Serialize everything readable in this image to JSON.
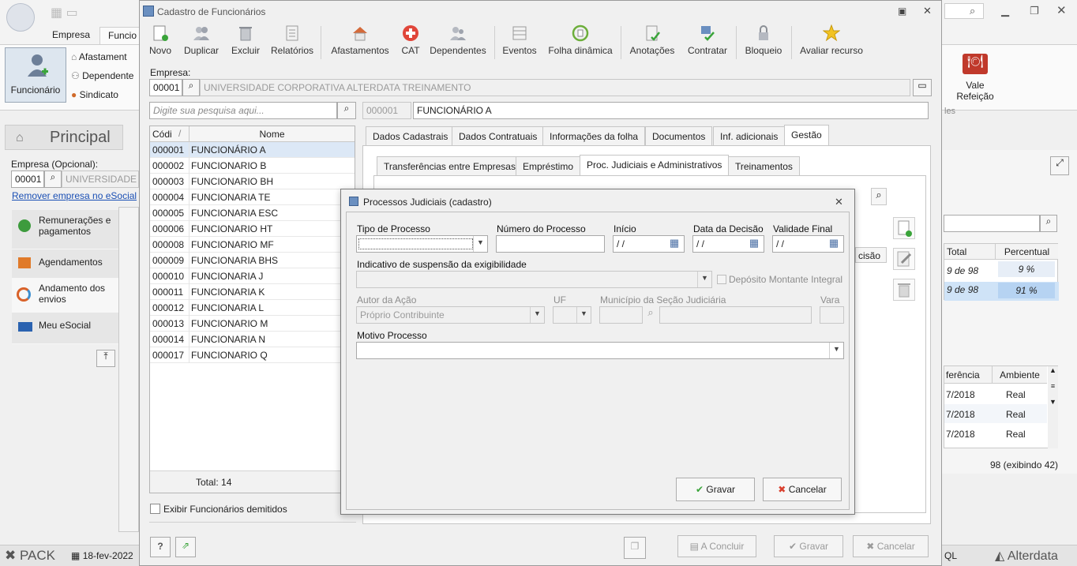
{
  "background": {
    "tabs": [
      "Empresa",
      "Funcio"
    ],
    "ribbon_big_button": "Funcionário",
    "ribbon_items": [
      "Afastament",
      "Dependente",
      "Sindicato"
    ],
    "ribbon_vale": "Vale Refeição",
    "ribbon_group": "les",
    "side_title": "Principal",
    "empresa_label": "Empresa (Opcional):",
    "empresa_code": "00001",
    "empresa_name": "UNIVERSIDADE C",
    "remove_link": "Remover empresa no eSocial",
    "menu": [
      "Remunerações e pagamentos",
      "Agendamentos",
      "Andamento dos envios",
      "Meu eSocial"
    ],
    "right_table": {
      "headers": [
        "Total",
        "Percentual"
      ],
      "rows": [
        [
          "9 de 98",
          "9 %"
        ],
        [
          "9 de 98",
          "91 %"
        ]
      ],
      "headers2": [
        "ferência",
        "Ambiente"
      ],
      "rows2": [
        [
          "7/2018",
          "Real"
        ],
        [
          "7/2018",
          "Real"
        ],
        [
          "7/2018",
          "Real"
        ]
      ],
      "footer": "98 (exibindo 42)",
      "left_snippet": "cisão"
    },
    "status": {
      "pack": "PACK",
      "date": "18-fev-2022",
      "sql": "QL",
      "brand": "Alterdata"
    }
  },
  "window": {
    "title": "Cadastro de Funcionários",
    "toolbar": [
      {
        "label": "Novo",
        "icon": "new-doc-icon"
      },
      {
        "label": "Duplicar",
        "icon": "duplicate-users-icon"
      },
      {
        "label": "Excluir",
        "icon": "trash-icon"
      },
      {
        "label": "Relatórios",
        "icon": "report-icon"
      },
      {
        "label": "Afastamentos",
        "icon": "house-icon"
      },
      {
        "label": "CAT",
        "icon": "red-cross-icon"
      },
      {
        "label": "Dependentes",
        "icon": "dependents-icon"
      },
      {
        "label": "Eventos",
        "icon": "events-icon"
      },
      {
        "label": "Folha dinâmica",
        "icon": "dynamic-sheet-icon"
      },
      {
        "label": "Anotações",
        "icon": "notes-icon"
      },
      {
        "label": "Contratar",
        "icon": "hire-icon"
      },
      {
        "label": "Bloqueio",
        "icon": "lock-icon"
      },
      {
        "label": "Avaliar recurso",
        "icon": "star-icon"
      }
    ],
    "empresa_label": "Empresa:",
    "empresa_code": "00001",
    "empresa_name": "UNIVERSIDADE CORPORATIVA ALTERDATA TREINAMENTO",
    "search_placeholder": "Digite sua pesquisa aqui...",
    "selected_code": "000001",
    "selected_name": "FUNCIONÁRIO A",
    "grid": {
      "headers": [
        "Códi",
        "Nome"
      ],
      "rows": [
        [
          "000001",
          "FUNCIONÁRIO A"
        ],
        [
          "000002",
          "FUNCIONARIO B"
        ],
        [
          "000003",
          "FUNCIONARIO BH"
        ],
        [
          "000004",
          "FUNCIONARIA TE"
        ],
        [
          "000005",
          "FUNCIONARIA ESC"
        ],
        [
          "000006",
          "FUNCIONARIO HT"
        ],
        [
          "000008",
          "FUNCIONARIO MF"
        ],
        [
          "000009",
          "FUNCIONARIA BHS"
        ],
        [
          "000010",
          "FUNCIONARIA J"
        ],
        [
          "000011",
          "FUNCIONARIA K"
        ],
        [
          "000012",
          "FUNCIONARIA L"
        ],
        [
          "000013",
          "FUNCIONARIO M"
        ],
        [
          "000014",
          "FUNCIONARIA N"
        ],
        [
          "000017",
          "FUNCIONARIO Q"
        ]
      ],
      "total": "Total: 14"
    },
    "show_dismissed": "Exibir Funcionários demitidos",
    "tabs": [
      "Dados Cadastrais",
      "Dados Contratuais",
      "Informações da folha",
      "Documentos",
      "Inf. adicionais",
      "Gestão"
    ],
    "subtabs": [
      "Transferências entre Empresas",
      "Empréstimo",
      "Proc. Judiciais e Administrativos",
      "Treinamentos"
    ],
    "footer": {
      "concluir": "A Concluir",
      "gravar": "Gravar",
      "cancelar": "Cancelar"
    }
  },
  "dialog": {
    "title": "Processos Judiciais (cadastro)",
    "tipo_label": "Tipo de Processo",
    "numero_label": "Número do Processo",
    "inicio_label": "Início",
    "decisao_label": "Data da Decisão",
    "validade_label": "Validade Final",
    "date_placeholder": "/ /",
    "suspensao_label": "Indicativo de suspensão da exigibilidade",
    "deposito_label": "Depósito Montante Integral",
    "autor_label": "Autor da Ação",
    "autor_value": "Próprio Contribuinte",
    "uf_label": "UF",
    "municipio_label": "Município da Seção Judiciária",
    "vara_label": "Vara",
    "motivo_label": "Motivo Processo",
    "gravar": "Gravar",
    "cancelar": "Cancelar"
  }
}
